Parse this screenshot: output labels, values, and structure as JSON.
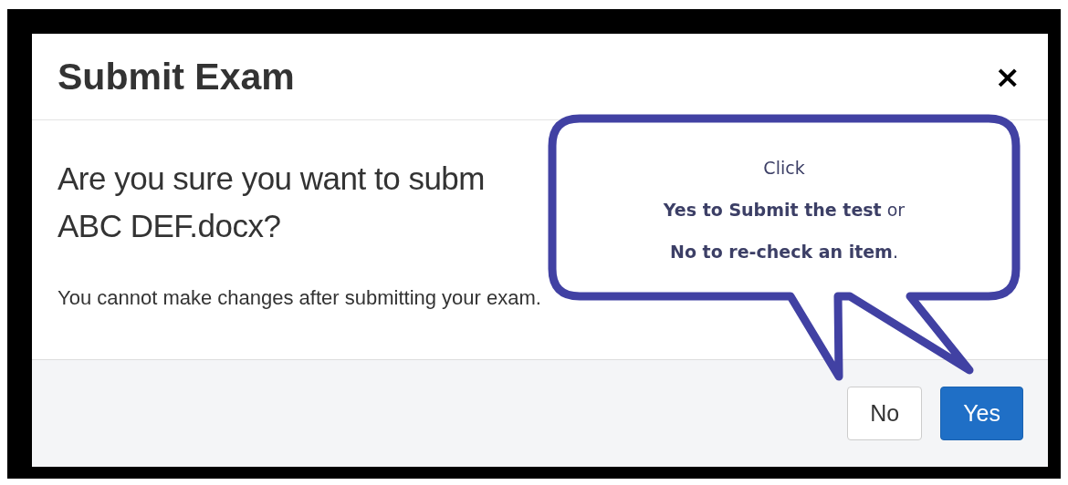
{
  "dialog": {
    "title": "Submit Exam",
    "close": "×",
    "question_lines": [
      "Are you sure you want to subm",
      "ABC DEF.docx?"
    ],
    "note": "You cannot make changes after submitting your exam.",
    "buttons": [
      {
        "label": "No",
        "kind": "default"
      },
      {
        "label": "Yes",
        "kind": "primary"
      }
    ]
  },
  "callout": {
    "lines": [
      "Click",
      "**Yes to Submit the test** or",
      "**No to re-check an item**."
    ]
  }
}
